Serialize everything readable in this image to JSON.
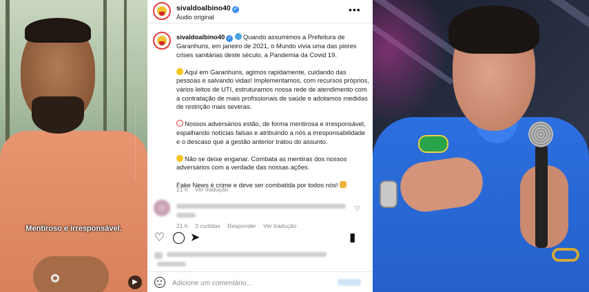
{
  "left_video": {
    "subtitle": "Mentiroso e irresponsável."
  },
  "post_header": {
    "username": "sivaldoalbino40",
    "verified": true,
    "audio_label": "Áudio original",
    "more_icon": "more-horizontal-icon"
  },
  "caption": {
    "username": "sivaldoalbino40",
    "p1": "Quando assumimos a Prefeitura de Garanhuns, em janeiro de 2021, o Mundo vivia uma das piores crises sanitárias deste século, a Pandemia da Covid 19.",
    "p2": "Aqui em Garanhuns, agimos rapidamente, cuidando das pessoas e salvando vidas! Implementamos, com recursos próprios, vários leitos de UTI, estruturamos nossa rede de atendimento com a contratação de mais profissionais de saúde e adotamos medidas de restrição mais severas.",
    "p3": "Nossos adversários estão, de forma mentirosa e irresponsável, espalhando notícias falsas e atribuindo a nós a irresponsabilidade e o descaso que a gestão anterior tratou do assunto.",
    "p4": "Não se deixe enganar. Combata as mentiras dos nossos adversários com a verdade das nossas ações.",
    "p5": "Fake News é crime e deve ser combatida por todos nós!"
  },
  "caption_meta": {
    "time": "21 h",
    "translate": "Ver tradução"
  },
  "comment_meta": {
    "time": "21 h",
    "likes": "3 curtidas",
    "reply": "Responder",
    "translate": "Ver tradução"
  },
  "comment_box": {
    "placeholder": "Adicione um comentário..."
  },
  "colors": {
    "verified_blue": "#3b8ef0",
    "avatar_ring": "#e2393a"
  }
}
